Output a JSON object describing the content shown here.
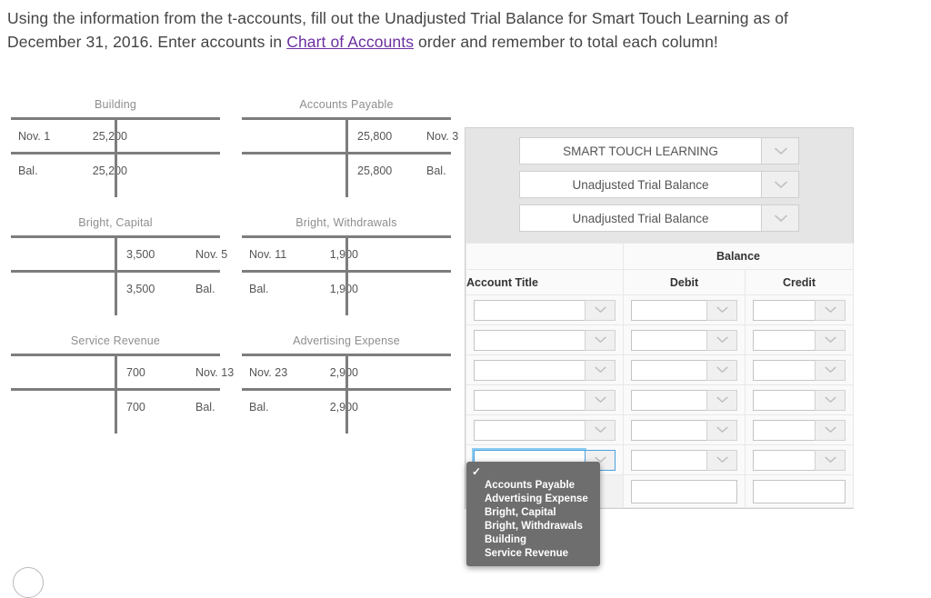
{
  "prompt": {
    "part1": "Using the information from the t-accounts, fill out the Unadjusted Trial Balance for Smart Touch Learning as of December 31, 2016. Enter accounts in ",
    "link": "Chart of Accounts",
    "part2": " order and remember to total each column!"
  },
  "taccounts": [
    {
      "title": "Building",
      "lines": [
        {
          "left_date": "Nov. 1",
          "left_amt": "25,200",
          "right_amt": "",
          "right_date": ""
        },
        {
          "left_date": "Bal.",
          "left_amt": "25,200",
          "right_amt": "",
          "right_date": ""
        }
      ]
    },
    {
      "title": "Accounts Payable",
      "lines": [
        {
          "left_date": "",
          "left_amt": "",
          "right_amt": "25,800",
          "right_date": "Nov. 3"
        },
        {
          "left_date": "",
          "left_amt": "",
          "right_amt": "25,800",
          "right_date": "Bal."
        }
      ]
    },
    {
      "title": "Bright, Capital",
      "lines": [
        {
          "left_date": "",
          "left_amt": "",
          "right_amt": "3,500",
          "right_date": "Nov. 5"
        },
        {
          "left_date": "",
          "left_amt": "",
          "right_amt": "3,500",
          "right_date": "Bal."
        }
      ]
    },
    {
      "title": "Bright, Withdrawals",
      "lines": [
        {
          "left_date": "Nov. 11",
          "left_amt": "1,900",
          "right_amt": "",
          "right_date": ""
        },
        {
          "left_date": "Bal.",
          "left_amt": "1,900",
          "right_amt": "",
          "right_date": ""
        }
      ]
    },
    {
      "title": "Service Revenue",
      "lines": [
        {
          "left_date": "",
          "left_amt": "",
          "right_amt": "700",
          "right_date": "Nov. 13"
        },
        {
          "left_date": "",
          "left_amt": "",
          "right_amt": "700",
          "right_date": "Bal."
        }
      ]
    },
    {
      "title": "Advertising Expense",
      "lines": [
        {
          "left_date": "Nov. 23",
          "left_amt": "2,900",
          "right_amt": "",
          "right_date": ""
        },
        {
          "left_date": "Bal.",
          "left_amt": "2,900",
          "right_amt": "",
          "right_date": ""
        }
      ]
    }
  ],
  "worksheet": {
    "header_selects": [
      {
        "value": "SMART TOUCH LEARNING"
      },
      {
        "value": "Unadjusted Trial Balance"
      },
      {
        "value": "Unadjusted Trial Balance"
      }
    ],
    "group_header": "Balance",
    "columns": [
      "Account Title",
      "Debit",
      "Credit"
    ],
    "rows": [
      {
        "account": "",
        "debit": "",
        "credit": ""
      },
      {
        "account": "",
        "debit": "",
        "credit": ""
      },
      {
        "account": "",
        "debit": "",
        "credit": ""
      },
      {
        "account": "",
        "debit": "",
        "credit": ""
      },
      {
        "account": "",
        "debit": "",
        "credit": ""
      },
      {
        "account": "",
        "debit": "",
        "credit": ""
      }
    ],
    "totals": {
      "label": "",
      "debit": "",
      "credit": ""
    },
    "focused_row_index": 5
  },
  "dropdown": {
    "selected_value": "",
    "check_glyph": "✓",
    "options": [
      "Accounts Payable",
      "Advertising Expense",
      "Bright, Capital",
      "Bright, Withdrawals",
      "Building",
      "Service Revenue"
    ]
  },
  "colors": {
    "link": "#6b2fa0",
    "rule": "#7d7d7d",
    "panel_header": "#e5e5e5",
    "focus_ring": "#4aa3df"
  }
}
